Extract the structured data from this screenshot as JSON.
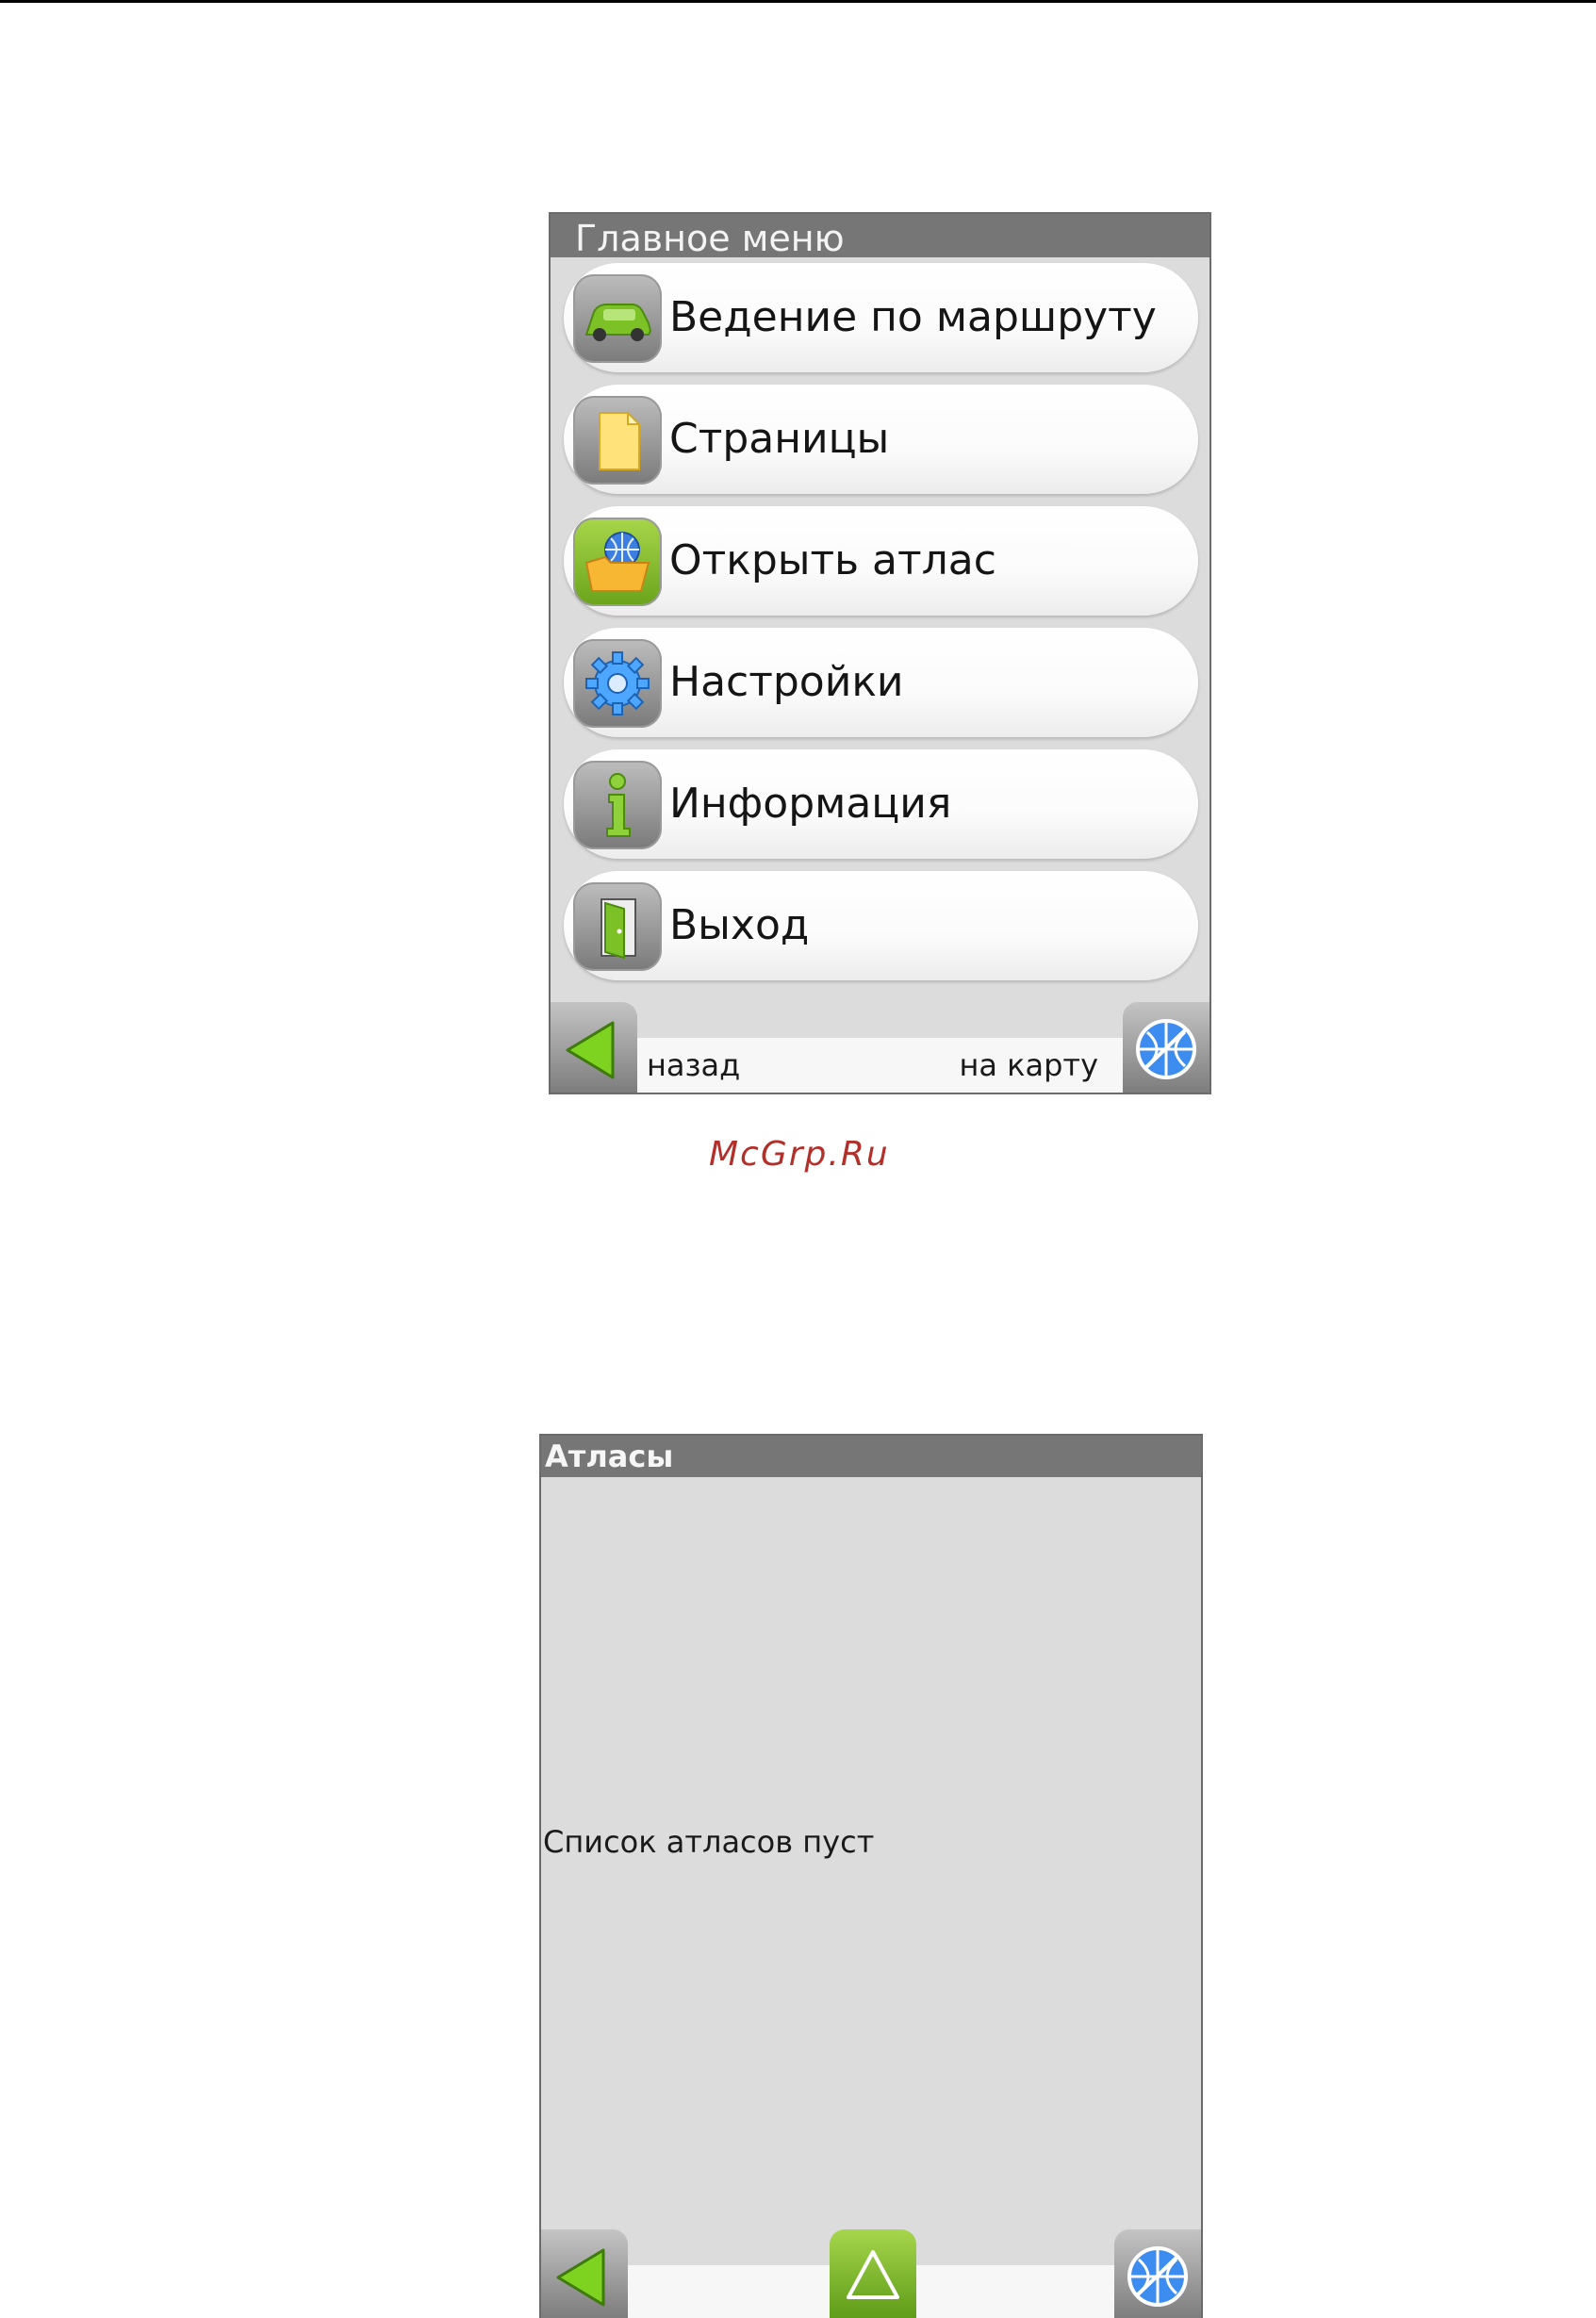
{
  "main_menu": {
    "title": "Главное меню",
    "items": [
      {
        "label": "Ведение по маршруту",
        "icon": "car-icon"
      },
      {
        "label": "Страницы",
        "icon": "page-icon"
      },
      {
        "label": "Открыть атлас",
        "icon": "atlas-folder-icon"
      },
      {
        "label": "Настройки",
        "icon": "gear-icon"
      },
      {
        "label": "Информация",
        "icon": "info-icon"
      },
      {
        "label": "Выход",
        "icon": "exit-door-icon"
      }
    ],
    "bottom_bar": {
      "back_label": "назад",
      "map_label": "на карту"
    }
  },
  "watermark": "McGrp.Ru",
  "atlases": {
    "title": "Атласы",
    "empty_message": "Список атласов пуст"
  },
  "colors": {
    "title_bar": "#767676",
    "screen_bg": "#dcdcdc",
    "accent_green": "#6aa41c",
    "watermark_red": "#b3302a"
  }
}
